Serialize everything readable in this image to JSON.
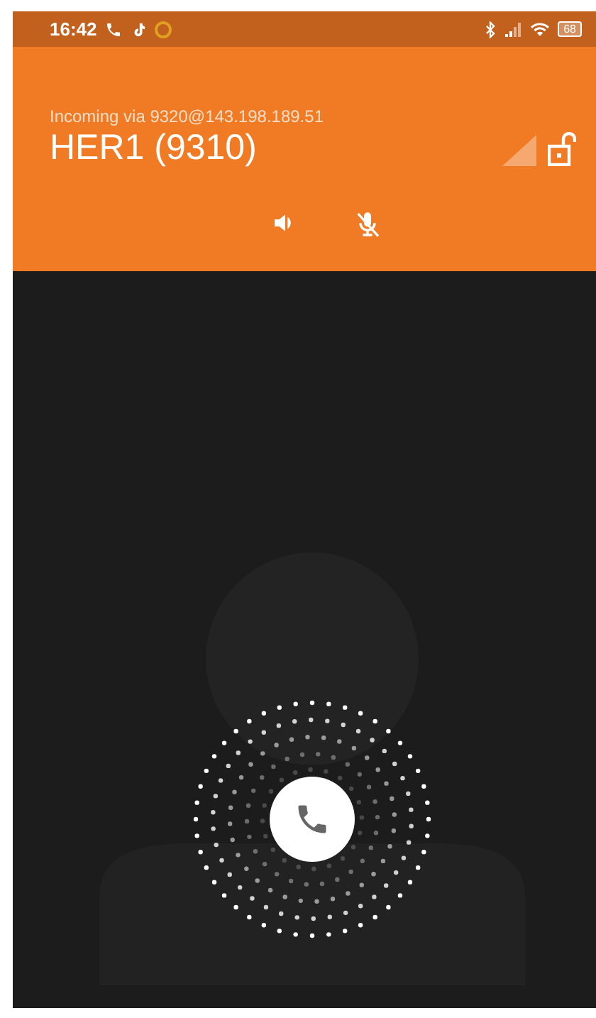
{
  "status_bar": {
    "time": "16:42",
    "battery": "68"
  },
  "call": {
    "via": "Incoming via 9320@143.198.189.51",
    "name": "HER1 (9310)"
  }
}
